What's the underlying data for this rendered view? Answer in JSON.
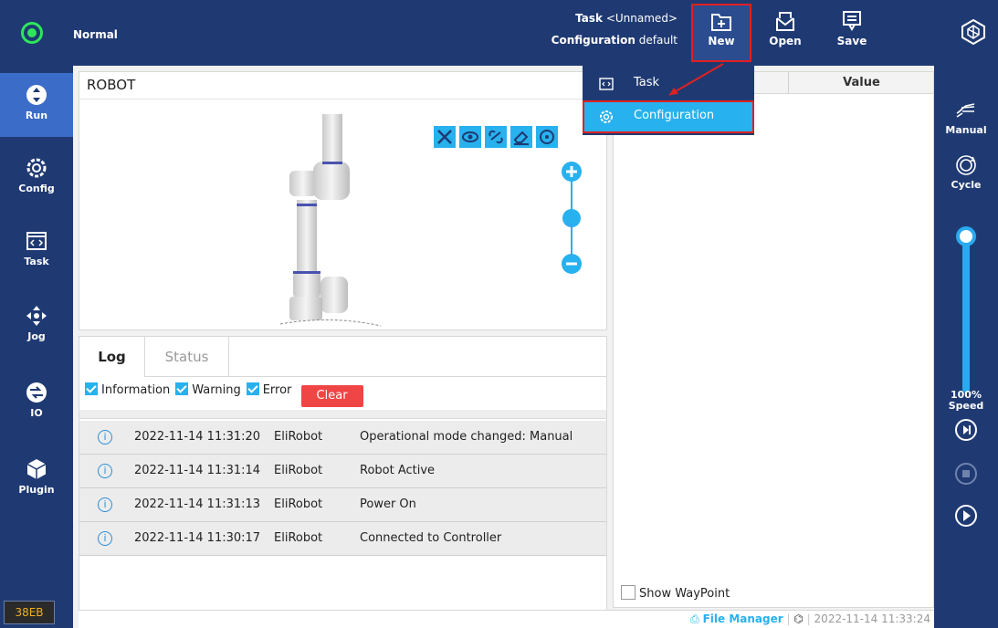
{
  "header": {
    "mode_label": "Normal",
    "task_label": "Task",
    "task_value": "<Unnamed>",
    "configuration_label": "Configuration",
    "configuration_value": "default",
    "buttons": {
      "new": "New",
      "open": "Open",
      "save": "Save"
    }
  },
  "dropdown": {
    "items": [
      {
        "label": "Task",
        "icon": "code-icon"
      },
      {
        "label": "Configuration",
        "icon": "gear-icon"
      }
    ]
  },
  "sidebar": {
    "items": [
      {
        "label": "Run",
        "icon": "run-icon",
        "active": true
      },
      {
        "label": "Config",
        "icon": "gear-icon"
      },
      {
        "label": "Task",
        "icon": "code-icon"
      },
      {
        "label": "Jog",
        "icon": "jog-icon"
      },
      {
        "label": "IO",
        "icon": "io-icon"
      },
      {
        "label": "Plugin",
        "icon": "plugin-icon"
      }
    ],
    "build_id": "38EB"
  },
  "right_sidebar": {
    "manual_label": "Manual",
    "cycle_label": "Cycle",
    "speed_value": "100%",
    "speed_label": "Speed",
    "speed_fraction": 1.0
  },
  "robot_panel": {
    "title": "ROBOT"
  },
  "log_panel": {
    "tabs": [
      "Log",
      "Status"
    ],
    "filters": [
      "Information",
      "Warning",
      "Error"
    ],
    "clear_label": "Clear",
    "rows": [
      {
        "time": "2022-11-14 11:31:20",
        "source": "EliRobot",
        "message": "Operational mode changed: Manual"
      },
      {
        "time": "2022-11-14 11:31:14",
        "source": "EliRobot",
        "message": "Robot Active"
      },
      {
        "time": "2022-11-14 11:31:13",
        "source": "EliRobot",
        "message": "Power On"
      },
      {
        "time": "2022-11-14 11:30:17",
        "source": "EliRobot",
        "message": "Connected to Controller"
      }
    ]
  },
  "value_panel": {
    "value_header": "Value",
    "show_waypoint_label": "Show WayPoint"
  },
  "statusbar": {
    "file_manager_label": "File Manager",
    "timestamp": "2022-11-14 11:33:24"
  },
  "colors": {
    "navy": "#1f3a73",
    "accent": "#27b1ee",
    "clear_red": "#f04545",
    "highlight_red": "#e02020",
    "mode_green": "#2ee65a"
  }
}
